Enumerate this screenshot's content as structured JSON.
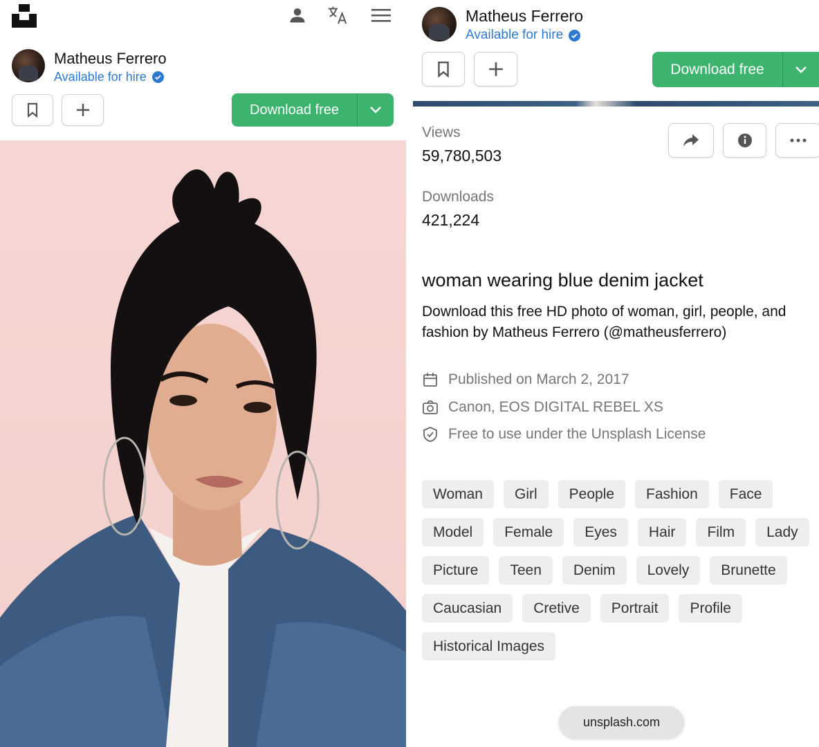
{
  "colors": {
    "accent_green": "#3cb46e",
    "hire_blue": "#2f7ad1",
    "tag_bg": "#eeeeee",
    "muted_text": "#767676"
  },
  "left": {
    "topbar": {
      "icons": [
        "unsplash-logo",
        "user-icon",
        "translate-icon",
        "menu-icon"
      ]
    },
    "user": {
      "name": "Matheus Ferrero",
      "hire": "Available for hire"
    },
    "actions": {
      "bookmark_icon": "bookmark-icon",
      "add_icon": "plus-icon",
      "download_label": "Download free"
    }
  },
  "right": {
    "user": {
      "name": "Matheus Ferrero",
      "hire": "Available for hire"
    },
    "actions": {
      "download_label": "Download free"
    },
    "stats": {
      "views_label": "Views",
      "views_value": "59,780,503",
      "downloads_label": "Downloads",
      "downloads_value": "421,224"
    },
    "secondary_icons": [
      "share-icon",
      "info-icon",
      "more-icon"
    ],
    "title": "woman wearing blue denim jacket",
    "description": "Download this free HD photo of woman, girl, people, and fashion by Matheus Ferrero (@matheusferrero)",
    "meta": {
      "published": "Published on March 2, 2017",
      "camera": "Canon, EOS DIGITAL REBEL XS",
      "license": "Free to use under the Unsplash License"
    },
    "tags": [
      "Woman",
      "Girl",
      "People",
      "Fashion",
      "Face",
      "Model",
      "Female",
      "Eyes",
      "Hair",
      "Film",
      "Lady",
      "Picture",
      "Teen",
      "Denim",
      "Lovely",
      "Brunette",
      "Caucasian",
      "Cretive",
      "Portrait",
      "Profile",
      "Historical Images"
    ],
    "url": "unsplash.com"
  }
}
